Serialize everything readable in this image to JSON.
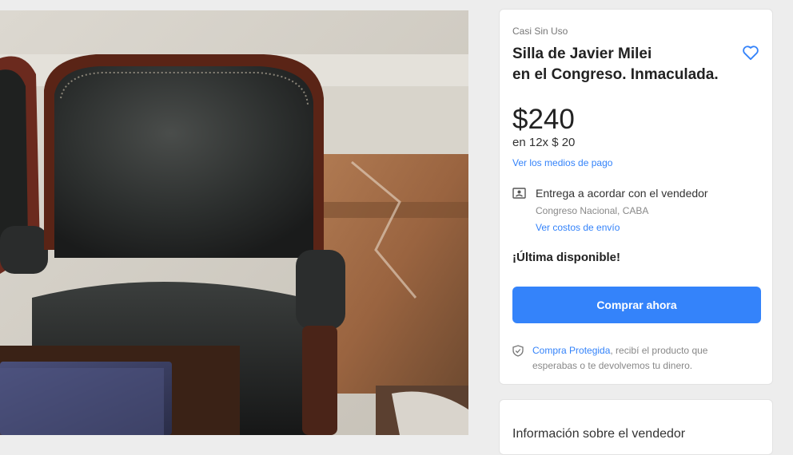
{
  "product": {
    "condition": "Casi Sin Uso",
    "title_line1": "Silla de Javier Milei",
    "title_line2": "en el Congreso. Inmaculada.",
    "price": "$240",
    "installments": "en 12x $ 20",
    "payment_link": "Ver los medios de pago",
    "stock_status": "¡Última disponible!",
    "buy_button_label": "Comprar ahora",
    "favorite_icon": "heart-outline-icon"
  },
  "delivery": {
    "icon": "handshake-card-icon",
    "title": "Entrega a acordar con el vendedor",
    "location": "Congreso Nacional, CABA",
    "shipping_link": "Ver costos de envío"
  },
  "protection": {
    "icon": "shield-check-icon",
    "link": "Compra Protegida",
    "text": ", recibí el producto que esperabas o te devolvemos tu dinero."
  },
  "seller": {
    "section_title": "Información sobre el vendedor"
  },
  "colors": {
    "accent": "#3483fa",
    "background": "#ededed",
    "card": "#ffffff"
  }
}
